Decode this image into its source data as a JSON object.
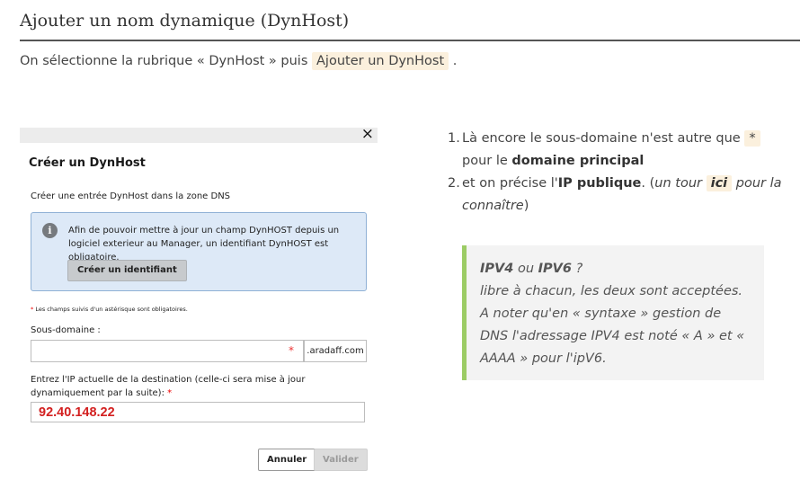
{
  "title": "Ajouter un nom dynamique (DynHost)",
  "intro": {
    "before": "On sélectionne la rubrique « DynHost » puis ",
    "highlight": "Ajouter un DynHost",
    "after": " ."
  },
  "dialog": {
    "close_icon": "close-icon",
    "close_glyph": "×",
    "title": "Créer un DynHost",
    "subtitle": "Créer une entrée DynHost dans la zone DNS",
    "info": {
      "icon": "info-icon",
      "icon_glyph": "i",
      "text": "Afin de pouvoir mettre à jour un champ DynHOST depuis un logiciel exterieur au Manager, un identifiant DynHOST est obligatoire.",
      "button": "Créer un identifiant"
    },
    "required_star": "*",
    "required_note": " Les champs suivis d'un astérisque sont obligatoires.",
    "subdomain": {
      "label": "Sous-domaine :",
      "value": "",
      "required_star": "*",
      "suffix": ".aradaff.com"
    },
    "ip": {
      "label": "Entrez l'IP actuelle de la destination (celle-ci sera mise à jour dynamiquement par la suite): ",
      "required_star": "*",
      "value": "92.40.148.22"
    },
    "cancel": "Annuler",
    "validate": "Valider"
  },
  "steps": [
    {
      "num": "1.",
      "before": "Là encore le sous-domaine n'est autre que ",
      "highlight": "*",
      "middle": " pour le ",
      "bold": "domaine principal"
    },
    {
      "num": "2.",
      "before": "et on précise l'",
      "bold": "IP publique",
      "middle": ". (",
      "italic_before": "un tour ",
      "highlight": "ici",
      "italic_after": " pour la connaître",
      "after": ")"
    }
  ],
  "quote": {
    "ipv4": "IPV4",
    "or": " ou ",
    "ipv6": "IPV6",
    "question": " ?",
    "text": "libre à chacun, les deux sont acceptées. A noter qu'en « syntaxe » gestion de DNS l'adressage IPV4 est noté « A » et « AAAA » pour l'ipV6."
  },
  "colors": {
    "highlight_bg": "#fbf0dd",
    "info_bg": "#dde9f7",
    "quote_border": "#9ccc65",
    "ip_text": "#d32020"
  }
}
